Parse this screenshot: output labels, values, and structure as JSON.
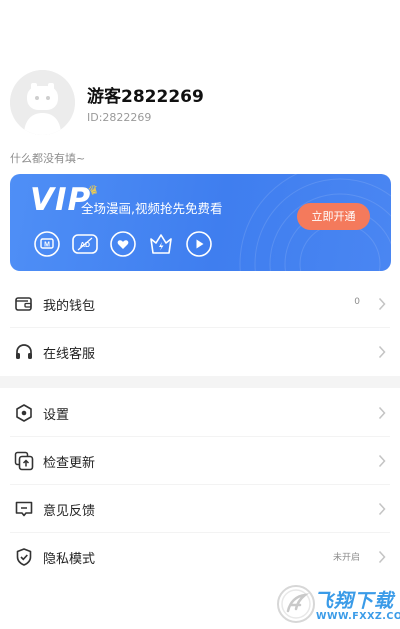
{
  "profile": {
    "username": "游客2822269",
    "user_id": "ID:2822269",
    "bio": "什么都没有填~"
  },
  "vip": {
    "logo_text": "VIP",
    "slogan": "全场漫画,视频抢先免费看",
    "button_label": "立即开通",
    "perk_icons": [
      "m-badge-icon",
      "ad-free-icon",
      "heart-icon",
      "crown-icon",
      "play-icon"
    ],
    "colors": {
      "card": "#4a86f2",
      "button": "#f47a5c",
      "crown": "#ffd23f"
    }
  },
  "menu": {
    "wallet": {
      "label": "我的钱包",
      "value": "0",
      "icon": "wallet-icon"
    },
    "service": {
      "label": "在线客服",
      "icon": "headset-icon"
    },
    "settings": {
      "label": "设置",
      "icon": "hexagon-settings-icon"
    },
    "update": {
      "label": "检查更新",
      "icon": "update-icon"
    },
    "feedback": {
      "label": "意见反馈",
      "icon": "feedback-icon"
    },
    "privacy": {
      "label": "隐私模式",
      "value": "未开启",
      "icon": "shield-check-icon"
    }
  },
  "watermark": {
    "name": "飞翔下载",
    "url": "WWW.FXXZ.COM"
  }
}
